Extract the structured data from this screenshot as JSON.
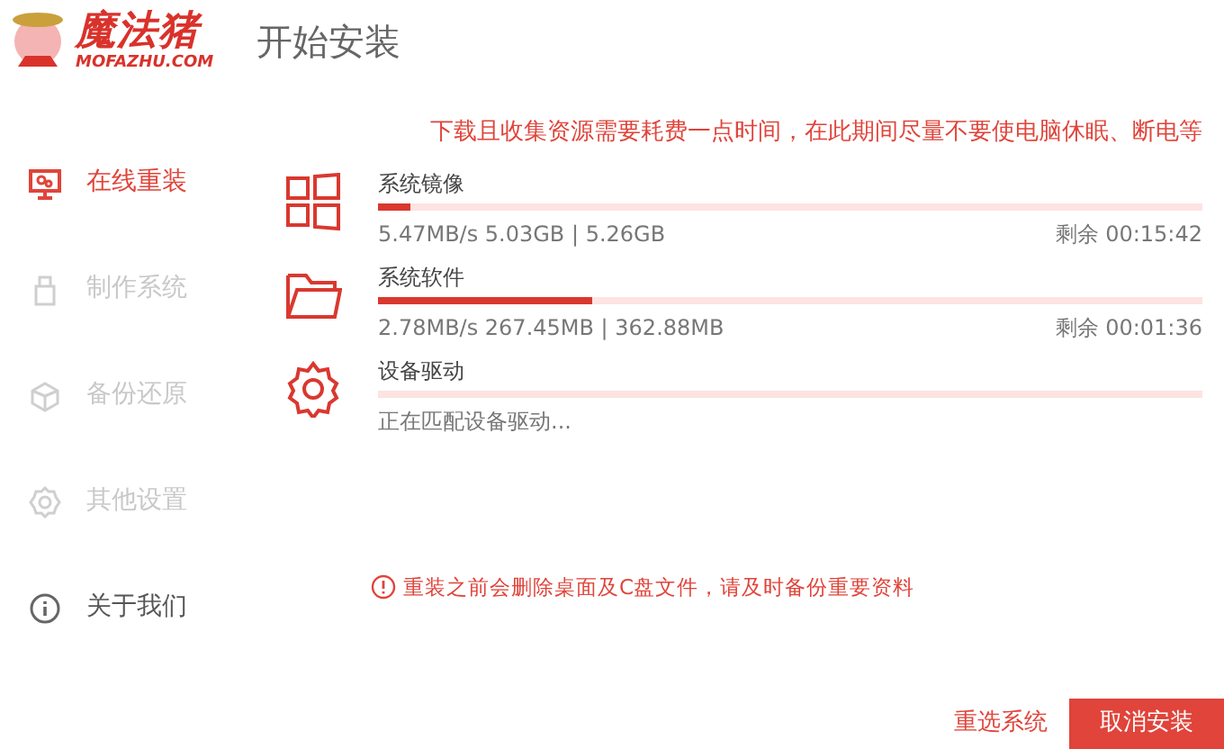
{
  "logo": {
    "name": "魔法猪",
    "domain": "MOFAZHU.COM"
  },
  "page_title": "开始安装",
  "sidebar": {
    "items": [
      {
        "label": "在线重装",
        "kind": "monitor",
        "selected": true,
        "disabled": false
      },
      {
        "label": "制作系统",
        "kind": "usb",
        "selected": false,
        "disabled": true
      },
      {
        "label": "备份还原",
        "kind": "cube",
        "selected": false,
        "disabled": true
      },
      {
        "label": "其他设置",
        "kind": "gear",
        "selected": false,
        "disabled": true
      },
      {
        "label": "关于我们",
        "kind": "info",
        "selected": false,
        "disabled": false
      }
    ]
  },
  "notice": "下载且收集资源需要耗费一点时间，在此期间尽量不要使电脑休眠、断电等",
  "tasks": [
    {
      "kind": "windows",
      "name": "系统镜像",
      "level": 0.04,
      "detail": "5.47MB/s 5.03GB | 5.26GB",
      "remaining": "剩余 00:15:42"
    },
    {
      "kind": "folder",
      "name": "系统软件",
      "level": 0.26,
      "detail": "2.78MB/s 267.45MB | 362.88MB",
      "remaining": "剩余 00:01:36"
    },
    {
      "kind": "gear",
      "name": "设备驱动",
      "level": 0,
      "detail": "正在匹配设备驱动..."
    }
  ],
  "warning": "重装之前会删除桌面及C盘文件，请及时备份重要资料",
  "buttons": [
    {
      "label": "重选系统",
      "kind": "link"
    },
    {
      "label": "取消安装",
      "kind": "primary"
    }
  ]
}
